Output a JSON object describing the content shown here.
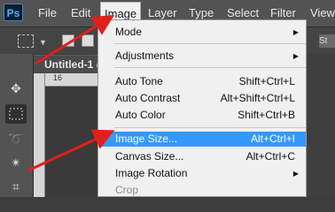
{
  "app": {
    "logo": "Ps"
  },
  "menubar": {
    "items": [
      "File",
      "Edit",
      "Image",
      "Layer",
      "Type",
      "Select",
      "Filter",
      "View"
    ],
    "active": "Image"
  },
  "document": {
    "tab_label": "Untitled-1 @",
    "ruler_number": "16"
  },
  "image_menu": {
    "items": [
      {
        "label": "Mode",
        "submenu": true
      },
      {
        "label": "Adjustments",
        "submenu": true
      },
      {
        "label": "Auto Tone",
        "shortcut": "Shift+Ctrl+L"
      },
      {
        "label": "Auto Contrast",
        "shortcut": "Alt+Shift+Ctrl+L"
      },
      {
        "label": "Auto Color",
        "shortcut": "Shift+Ctrl+B"
      },
      {
        "label": "Image Size...",
        "shortcut": "Alt+Ctrl+I",
        "highlighted": true
      },
      {
        "label": "Canvas Size...",
        "shortcut": "Alt+Ctrl+C"
      },
      {
        "label": "Image Rotation",
        "submenu": true
      },
      {
        "label": "Crop",
        "disabled": true
      }
    ]
  },
  "optionsbar": {
    "right_label": "St"
  },
  "tools": [
    "move-icon",
    "marquee-icon",
    "lasso-icon",
    "magic-wand-icon",
    "crop-icon"
  ],
  "annotation_color": "#e0201c"
}
